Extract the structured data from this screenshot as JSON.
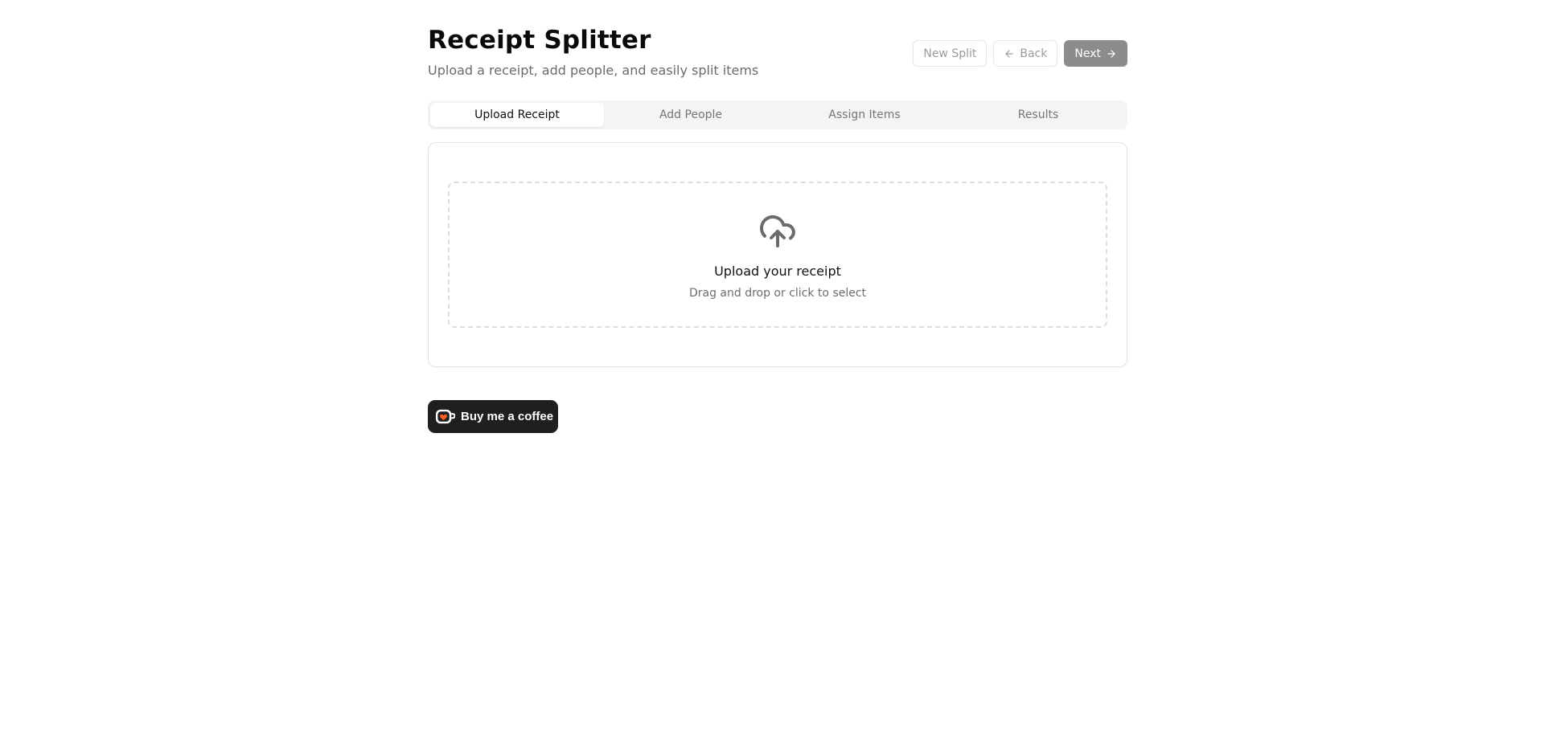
{
  "header": {
    "title": "Receipt Splitter",
    "subtitle": "Upload a receipt, add people, and easily split items"
  },
  "actions": {
    "new_split_label": "New Split",
    "back_label": "Back",
    "next_label": "Next",
    "back_icon": "arrow-left-icon",
    "next_icon": "arrow-right-icon"
  },
  "tabs": [
    {
      "label": "Upload Receipt",
      "active": true
    },
    {
      "label": "Add People",
      "active": false
    },
    {
      "label": "Assign Items",
      "active": false
    },
    {
      "label": "Results",
      "active": false
    }
  ],
  "upload": {
    "icon": "cloud-upload-icon",
    "title": "Upload your receipt",
    "hint": "Drag and drop or click to select"
  },
  "coffee": {
    "label": "Buy me a coffee",
    "icon": "coffee-cup-icon"
  },
  "colors": {
    "primary_disabled": "#8c8c8c",
    "coffee_bg": "#1f1f1f",
    "coffee_heart": "#ff5f24"
  }
}
